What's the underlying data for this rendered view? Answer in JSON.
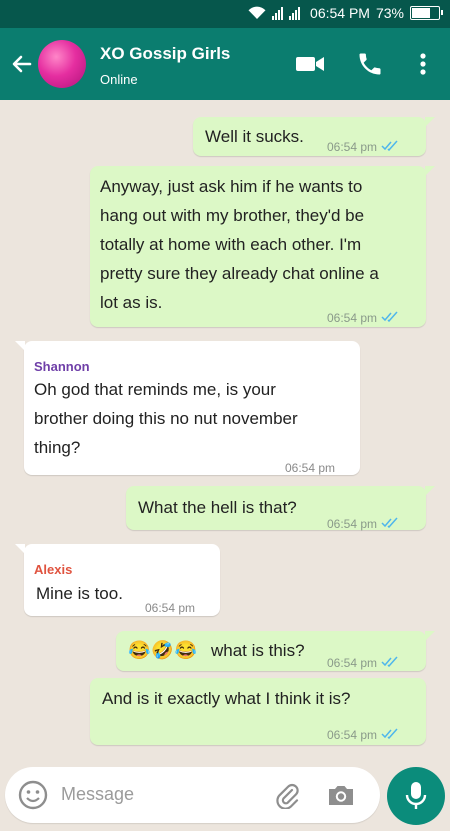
{
  "status_bar": {
    "time": "06:54 PM",
    "battery_percent": "73%",
    "battery_level": 0.73
  },
  "header": {
    "title": "XO Gossip Girls",
    "subtitle": "Online"
  },
  "messages": [
    {
      "text": "Well it sucks.",
      "time": "06:54 pm",
      "outgoing": true,
      "read": true
    },
    {
      "lines": [
        "Anyway, just ask him if he wants to",
        "hang out with my brother, they'd be",
        "totally at home with each other. I'm",
        "pretty sure they already chat online a",
        "lot as is."
      ],
      "time": "06:54 pm",
      "outgoing": true,
      "read": true
    },
    {
      "sender": "Shannon",
      "sender_color": "#6f3fa8",
      "lines": [
        "Oh god that reminds me, is your",
        "brother doing this no nut november",
        "thing?"
      ],
      "time": "06:54 pm",
      "outgoing": false
    },
    {
      "text": "What the hell is that?",
      "time": "06:54 pm",
      "outgoing": true,
      "read": true
    },
    {
      "sender": "Alexis",
      "sender_color": "#e0533f",
      "text": "Mine is too.",
      "time": "06:54 pm",
      "outgoing": false
    },
    {
      "emojis": [
        "😂",
        "🤣",
        "😂"
      ],
      "text": "what is this?",
      "time": "06:54 pm",
      "outgoing": true,
      "read": true
    },
    {
      "text": "And is it exactly what I think it is?",
      "time": "06:54 pm",
      "outgoing": true,
      "read": true
    }
  ],
  "composer": {
    "placeholder": "Message"
  },
  "colors": {
    "header": "#0b7d6f",
    "status_bar": "#06574c",
    "outgoing_bubble": "#dcf8c6",
    "read_ticks": "#4fb6ec"
  }
}
